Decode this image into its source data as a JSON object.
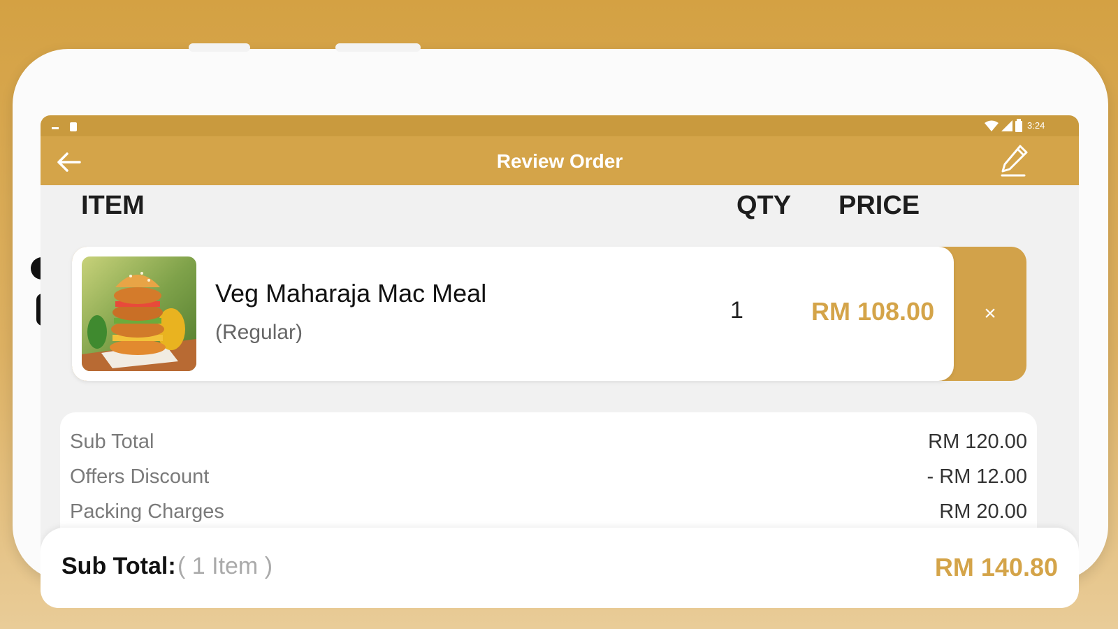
{
  "status_bar": {
    "time": "3:24"
  },
  "app_bar": {
    "title": "Review Order",
    "back_icon": "arrow-left-icon",
    "edit_icon": "pencil-icon"
  },
  "table_header": {
    "item": "ITEM",
    "qty": "QTY",
    "price": "PRICE"
  },
  "items": [
    {
      "name": "Veg Maharaja Mac Meal",
      "variant": "(Regular)",
      "qty": "1",
      "price": "RM 108.00",
      "remove_symbol": "×"
    }
  ],
  "summary": {
    "rows": [
      {
        "label": "Sub Total",
        "value": "RM 120.00"
      },
      {
        "label": "Offers Discount",
        "value": "- RM 12.00"
      },
      {
        "label": "Packing Charges",
        "value": "RM 20.00"
      }
    ]
  },
  "footer": {
    "label": "Sub Total:",
    "count": "( 1 Item )",
    "total": "RM 140.80"
  },
  "colors": {
    "accent": "#d4a449",
    "background": "#d4a143"
  }
}
